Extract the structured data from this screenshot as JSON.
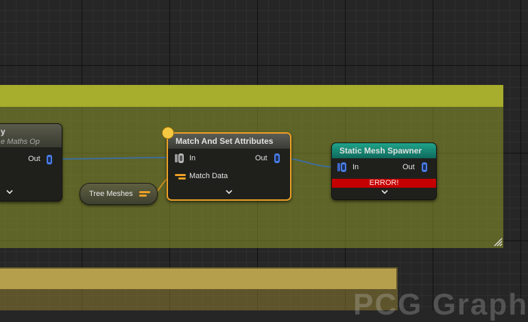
{
  "watermark": "PCG Graph",
  "nodes": {
    "left": {
      "title": "y",
      "subtitle": "e Maths Op",
      "out_label": "Out"
    },
    "match": {
      "title": "Match And Set Attributes",
      "in_label": "In",
      "out_label": "Out",
      "match_data_label": "Match Data"
    },
    "spawner": {
      "title": "Static Mesh Spawner",
      "in_label": "In",
      "out_label": "Out",
      "error": "ERROR!"
    }
  },
  "tree_meshes": {
    "label": "Tree Meshes"
  },
  "colors": {
    "comment_fill": "#8c9628",
    "comment_header": "#a7ad2c",
    "comment2_header": "#b59e4c",
    "match_border": "#f0a226",
    "spawner_header": "#1fa38a",
    "error": "#c40000",
    "spatial_pin": "#4a7de8",
    "attribute_pin": "#f0a226",
    "wire_spatial": "#3d6ea0",
    "wire_attribute": "#c88c20"
  }
}
